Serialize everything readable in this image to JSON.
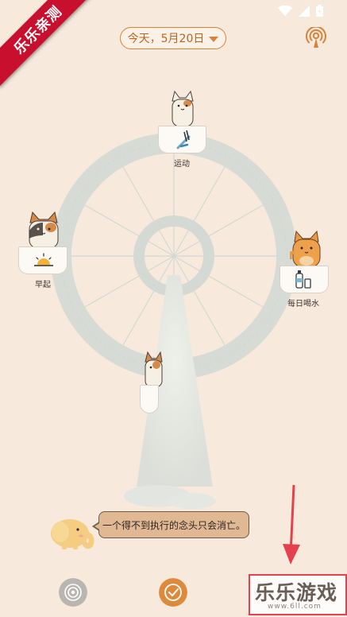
{
  "ribbon": {
    "text": "乐乐亲测"
  },
  "header": {
    "date_label": "今天，5月20日"
  },
  "habits": [
    {
      "label": "运动",
      "icon": "exercise-icon"
    },
    {
      "label": "早起",
      "icon": "sunrise-icon"
    },
    {
      "label": "每日喝水",
      "icon": "water-bottle-icon"
    }
  ],
  "quote": {
    "text": "一个得不到执行的念头只会消亡。"
  },
  "watermark": {
    "title": "乐乐游戏",
    "subtitle": "www.6ll.com"
  },
  "colors": {
    "background": "#f7eadc",
    "accent": "#d8823a",
    "wheel": "#d6dbd6"
  }
}
